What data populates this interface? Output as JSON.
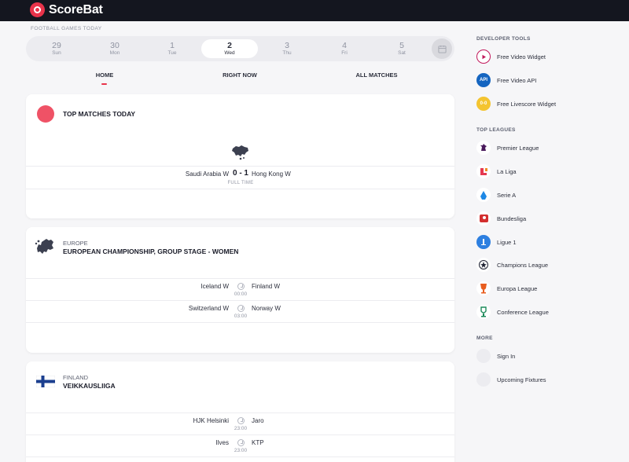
{
  "app": {
    "brand": "ScoreBat"
  },
  "dates": {
    "caption": "FOOTBALL GAMES TODAY",
    "items": [
      {
        "num": "29",
        "day": "Sun"
      },
      {
        "num": "30",
        "day": "Mon"
      },
      {
        "num": "1",
        "day": "Tue"
      },
      {
        "num": "2",
        "day": "Wed",
        "active": true
      },
      {
        "num": "3",
        "day": "Thu"
      },
      {
        "num": "4",
        "day": "Fri"
      },
      {
        "num": "5",
        "day": "Sat"
      }
    ],
    "calendar_icon": "calendar-icon"
  },
  "tabs": [
    {
      "label": "HOME",
      "active": true
    },
    {
      "label": "RIGHT NOW"
    },
    {
      "label": "ALL MATCHES"
    }
  ],
  "top_matches": {
    "title": "TOP MATCHES TODAY",
    "match": {
      "home": "Saudi Arabia W",
      "score": "0 - 1",
      "away": "Hong Kong W",
      "status": "FULL TIME"
    }
  },
  "competitions": [
    {
      "region": "EUROPE",
      "name": "EUROPEAN CHAMPIONSHIP, GROUP STAGE - WOMEN",
      "matches": [
        {
          "home": "Iceland W",
          "away": "Finland W",
          "time": "00:00"
        },
        {
          "home": "Switzerland W",
          "away": "Norway W",
          "time": "03:00"
        }
      ]
    },
    {
      "region": "FINLAND",
      "name": "VEIKKAUSLIIGA",
      "matches": [
        {
          "home": "HJK Helsinki",
          "away": "Jaro",
          "time": "23:00"
        },
        {
          "home": "Ilves",
          "away": "KTP",
          "time": "23:00"
        }
      ]
    }
  ],
  "sidebar": {
    "developer_tools": {
      "caption": "DEVELOPER TOOLS",
      "items": [
        {
          "label": "Free Video Widget",
          "icon": "play-icon"
        },
        {
          "label": "Free Video API",
          "icon": "api-icon",
          "icon_text": "API"
        },
        {
          "label": "Free Livescore Widget",
          "icon": "livescore-icon",
          "icon_text": "0-0"
        }
      ]
    },
    "top_leagues": {
      "caption": "TOP LEAGUES",
      "items": [
        {
          "label": "Premier League",
          "icon": "premier-league-icon"
        },
        {
          "label": "La Liga",
          "icon": "la-liga-icon"
        },
        {
          "label": "Serie A",
          "icon": "serie-a-icon"
        },
        {
          "label": "Bundesliga",
          "icon": "bundesliga-icon"
        },
        {
          "label": "Ligue 1",
          "icon": "ligue-1-icon"
        },
        {
          "label": "Champions League",
          "icon": "champions-league-icon"
        },
        {
          "label": "Europa League",
          "icon": "europa-league-icon"
        },
        {
          "label": "Conference League",
          "icon": "conference-league-icon"
        }
      ]
    },
    "more": {
      "caption": "MORE",
      "items": [
        {
          "label": "Sign In",
          "icon": "sign-in-icon"
        },
        {
          "label": "Upcoming Fixtures",
          "icon": "fixtures-icon"
        }
      ]
    }
  },
  "colors": {
    "accent": "#e8334a",
    "topbar": "#14161f",
    "background": "#f6f6f8"
  }
}
